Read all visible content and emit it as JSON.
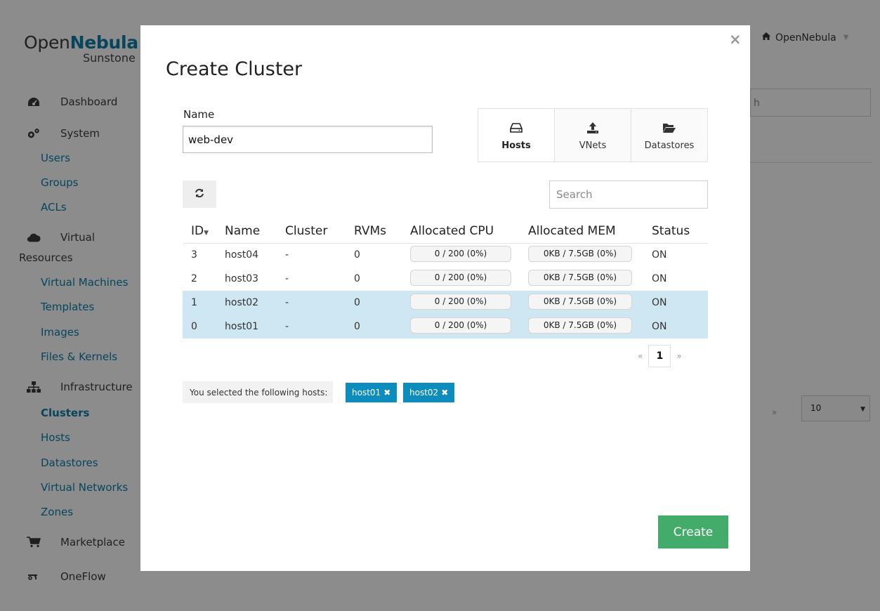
{
  "app": {
    "logo_prefix": "Open",
    "logo_brand": "Nebula",
    "logo_sub": "Sunstone",
    "user_menu_label": "OpenNebula",
    "bg_search_text": "h",
    "bg_pager_next": "»",
    "bg_select_value": "10"
  },
  "sidebar": {
    "dashboard": "Dashboard",
    "system": "System",
    "users": "Users",
    "groups": "Groups",
    "acls": "ACLs",
    "virtual": "Virtual",
    "resources": "Resources",
    "virtual_machines": "Virtual Machines",
    "templates": "Templates",
    "images": "Images",
    "files_kernels": "Files & Kernels",
    "infrastructure": "Infrastructure",
    "clusters": "Clusters",
    "hosts": "Hosts",
    "datastores": "Datastores",
    "virtual_networks": "Virtual Networks",
    "zones": "Zones",
    "marketplace": "Marketplace",
    "oneflow": "OneFlow"
  },
  "modal": {
    "close": "×",
    "title": "Create Cluster",
    "name_label": "Name",
    "name_value": "web-dev",
    "tabs": [
      {
        "label": "Hosts",
        "icon": "hdd-icon"
      },
      {
        "label": "VNets",
        "icon": "upload-icon"
      },
      {
        "label": "Datastores",
        "icon": "folder-open-icon"
      }
    ],
    "search_placeholder": "Search",
    "columns": [
      "ID",
      "Name",
      "Cluster",
      "RVMs",
      "Allocated CPU",
      "Allocated MEM",
      "Status"
    ],
    "rows": [
      {
        "id": "3",
        "name": "host04",
        "cluster": "-",
        "rvms": "0",
        "cpu": "0 / 200 (0%)",
        "mem": "0KB / 7.5GB (0%)",
        "status": "ON",
        "selected": false
      },
      {
        "id": "2",
        "name": "host03",
        "cluster": "-",
        "rvms": "0",
        "cpu": "0 / 200 (0%)",
        "mem": "0KB / 7.5GB (0%)",
        "status": "ON",
        "selected": false
      },
      {
        "id": "1",
        "name": "host02",
        "cluster": "-",
        "rvms": "0",
        "cpu": "0 / 200 (0%)",
        "mem": "0KB / 7.5GB (0%)",
        "status": "ON",
        "selected": true
      },
      {
        "id": "0",
        "name": "host01",
        "cluster": "-",
        "rvms": "0",
        "cpu": "0 / 200 (0%)",
        "mem": "0KB / 7.5GB (0%)",
        "status": "ON",
        "selected": true
      }
    ],
    "pager": {
      "prev": "«",
      "current": "1",
      "next": "»"
    },
    "selected_label": "You selected the following hosts:",
    "selected_hosts": [
      "host01",
      "host02"
    ],
    "create_label": "Create"
  },
  "colors": {
    "brand": "#0b7fa8",
    "link": "#0a7fa9",
    "selected_row": "#cfe7f2",
    "chip": "#0c8dbd",
    "create_button": "#43ac6a"
  }
}
